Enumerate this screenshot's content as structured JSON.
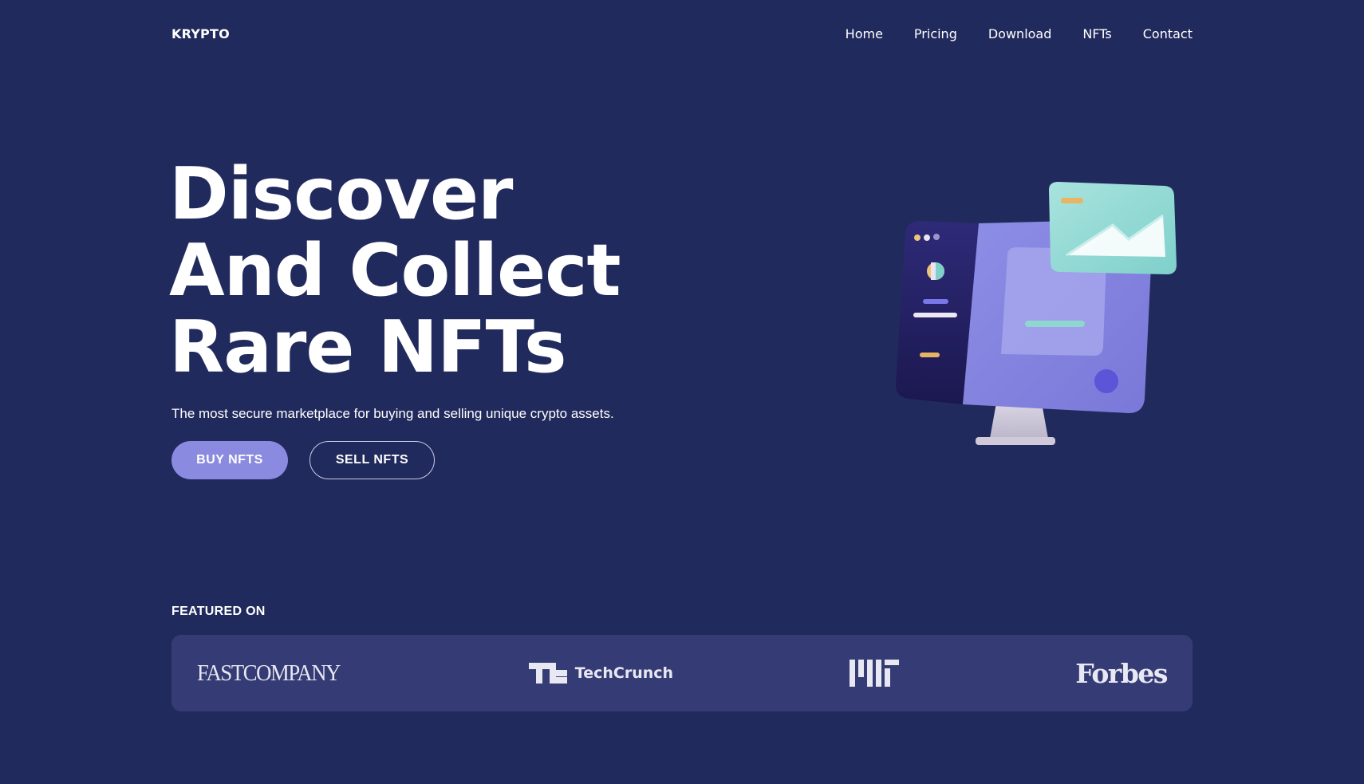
{
  "header": {
    "brand": "KRYPTO",
    "nav": [
      "Home",
      "Pricing",
      "Download",
      "NFTs",
      "Contact"
    ]
  },
  "hero": {
    "title_lines": [
      "Discover",
      "And Collect",
      "Rare NFTs"
    ],
    "subtitle": "The most secure marketplace for buying and selling unique crypto assets.",
    "buy_label": "BUY NFTS",
    "sell_label": "SELL NFTS"
  },
  "illustration": {
    "icon": "computer-monitor-illustration"
  },
  "featured": {
    "label": "FEATURED ON",
    "logos": {
      "fast_company": "FASTCOMPANY",
      "techcrunch": "TechCrunch",
      "mit": "MIT",
      "forbes": "Forbes"
    }
  },
  "colors": {
    "background": "#212a5c",
    "accent": "#8a8ae0",
    "featured_bar": "#353c75"
  }
}
